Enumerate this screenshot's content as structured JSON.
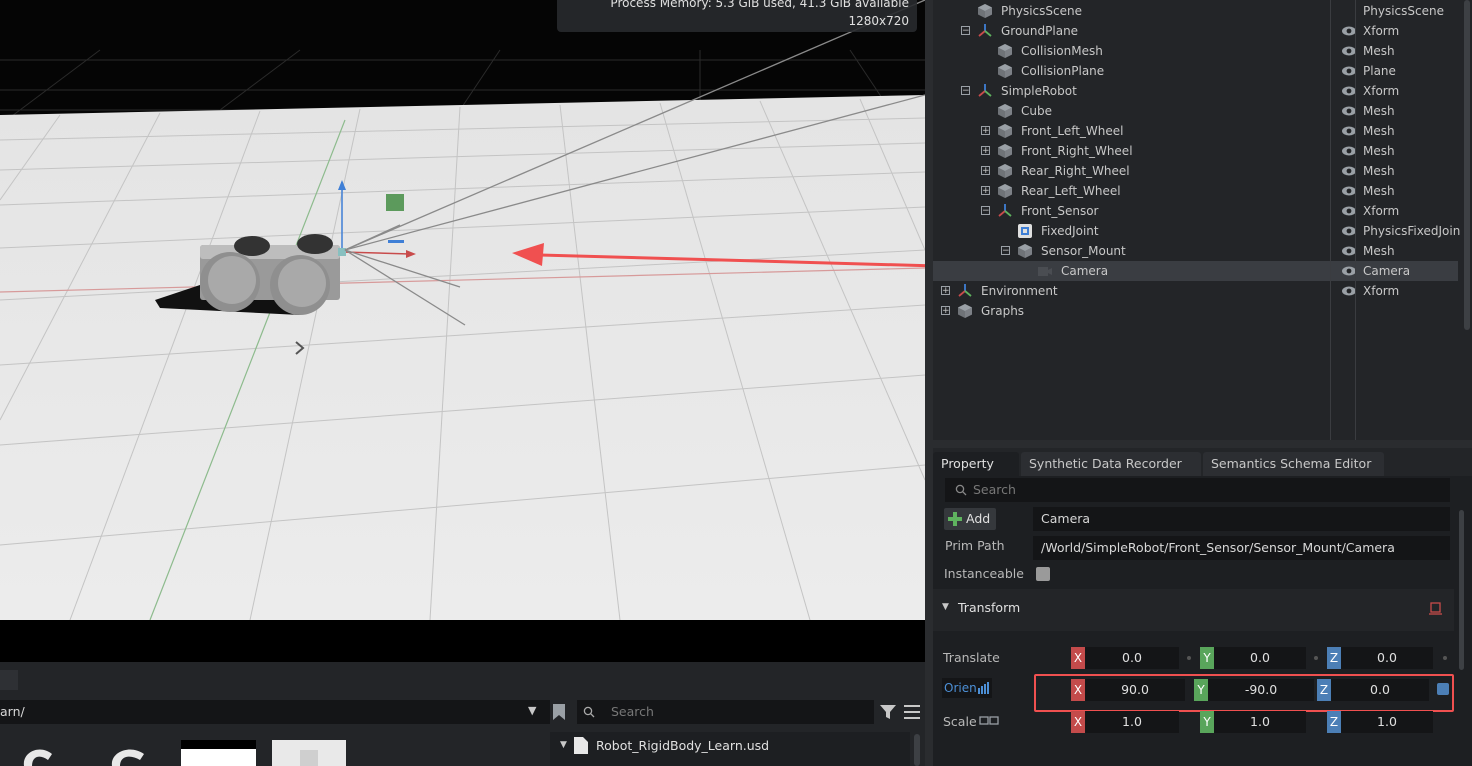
{
  "viewport": {
    "info_lines": [
      "Process Memory: 5.3 GiB used, 41.3 GiB available",
      "1280x720"
    ]
  },
  "stage": {
    "rows": [
      {
        "name": "PhysicsScene",
        "type": "PhysicsScene",
        "icon": "cube-icon",
        "indent": 1,
        "expand": "",
        "eye": false
      },
      {
        "name": "GroundPlane",
        "type": "Xform",
        "icon": "xform-icon",
        "indent": 1,
        "expand": "−",
        "eye": true
      },
      {
        "name": "CollisionMesh",
        "type": "Mesh",
        "icon": "cube-icon",
        "indent": 2,
        "expand": "",
        "eye": true
      },
      {
        "name": "CollisionPlane",
        "type": "Plane",
        "icon": "cube-icon",
        "indent": 2,
        "expand": "",
        "eye": true
      },
      {
        "name": "SimpleRobot",
        "type": "Xform",
        "icon": "xform-icon",
        "indent": 1,
        "expand": "−",
        "eye": true
      },
      {
        "name": "Cube",
        "type": "Mesh",
        "icon": "cube-icon",
        "indent": 2,
        "expand": "",
        "eye": true
      },
      {
        "name": "Front_Left_Wheel",
        "type": "Mesh",
        "icon": "cube-icon",
        "indent": 2,
        "expand": "+",
        "eye": true
      },
      {
        "name": "Front_Right_Wheel",
        "type": "Mesh",
        "icon": "cube-icon",
        "indent": 2,
        "expand": "+",
        "eye": true
      },
      {
        "name": "Rear_Right_Wheel",
        "type": "Mesh",
        "icon": "cube-icon",
        "indent": 2,
        "expand": "+",
        "eye": true
      },
      {
        "name": "Rear_Left_Wheel",
        "type": "Mesh",
        "icon": "cube-icon",
        "indent": 2,
        "expand": "+",
        "eye": true
      },
      {
        "name": "Front_Sensor",
        "type": "Xform",
        "icon": "xform-icon",
        "indent": 2,
        "expand": "−",
        "eye": true
      },
      {
        "name": "FixedJoint",
        "type": "PhysicsFixedJoin",
        "icon": "joint-icon",
        "indent": 3,
        "expand": "",
        "eye": true
      },
      {
        "name": "Sensor_Mount",
        "type": "Mesh",
        "icon": "cube-icon",
        "indent": 3,
        "expand": "−",
        "eye": true
      },
      {
        "name": "Camera",
        "type": "Camera",
        "icon": "camera-icon",
        "indent": 4,
        "expand": "",
        "eye": true,
        "selected": true
      },
      {
        "name": "Environment",
        "type": "Xform",
        "icon": "xform-icon",
        "indent": 0,
        "expand": "+",
        "eye": true
      },
      {
        "name": "Graphs",
        "type": "",
        "icon": "cube-icon",
        "indent": 0,
        "expand": "+",
        "eye": false
      }
    ]
  },
  "property": {
    "tabs": [
      "Property",
      "Synthetic Data Recorder",
      "Semantics Schema Editor"
    ],
    "search_placeholder": "Search",
    "add_label": "Add",
    "prim_name": "Camera",
    "prim_path_label": "Prim Path",
    "prim_path": "/World/SimpleRobot/Front_Sensor/Sensor_Mount/Camera",
    "instanceable_label": "Instanceable",
    "transform_label": "Transform",
    "translate_label": "Translate",
    "orient_label": "Orien",
    "scale_label": "Scale",
    "translate": {
      "x": "0.0",
      "y": "0.0",
      "z": "0.0"
    },
    "orient": {
      "x": "90.0",
      "y": "-90.0",
      "z": "0.0"
    },
    "scale": {
      "x": "1.0",
      "y": "1.0",
      "z": "1.0"
    }
  },
  "content_browser": {
    "path": "arn/",
    "search_placeholder": "Search",
    "file_name": "Robot_RigidBody_Learn.usd"
  },
  "colors": {
    "annotation_red": "#f05050",
    "axis_x": "#c44b4b",
    "axis_y": "#59a55b",
    "axis_z": "#4c7fb6",
    "selection": "#3a3d42"
  }
}
